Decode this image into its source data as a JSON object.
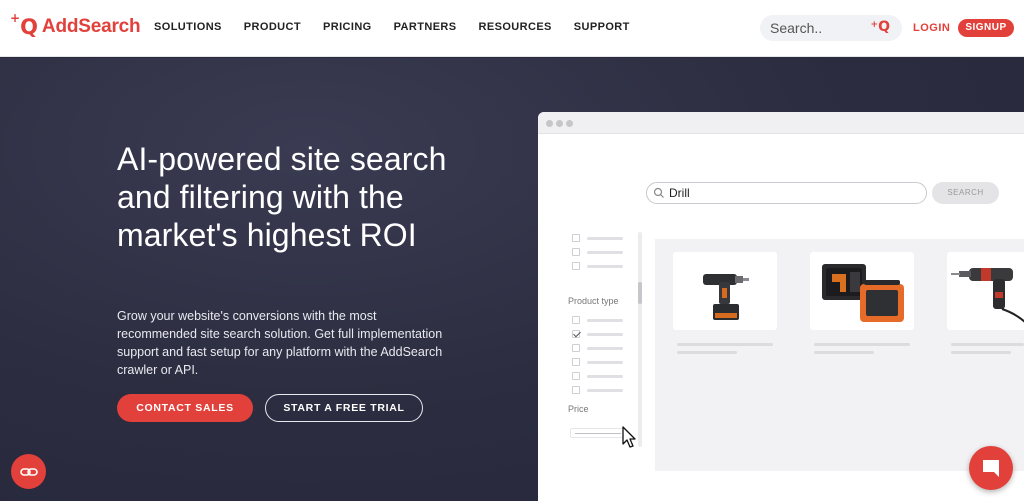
{
  "nav": {
    "logo_text": "AddSearch",
    "menu": [
      "SOLUTIONS",
      "PRODUCT",
      "PRICING",
      "PARTNERS",
      "RESOURCES",
      "SUPPORT"
    ],
    "search_placeholder": "Search..",
    "login": "LOGIN",
    "signup": "SIGNUP"
  },
  "hero": {
    "title": "AI-powered site search and filtering with the market's highest ROI",
    "description": "Grow your website's conversions with the most recommended site search solution. Get full implementation support and fast setup for any platform with the AddSearch crawler or API.",
    "contact_button": "CONTACT SALES",
    "trial_button": "START A FREE TRIAL"
  },
  "mockup": {
    "search_value": "Drill",
    "search_button": "SEARCH",
    "filter_label_1": "Product type",
    "filter_label_2": "Price"
  },
  "colors": {
    "brand": "#e2403a",
    "hero_bg": "#2c2d40"
  }
}
